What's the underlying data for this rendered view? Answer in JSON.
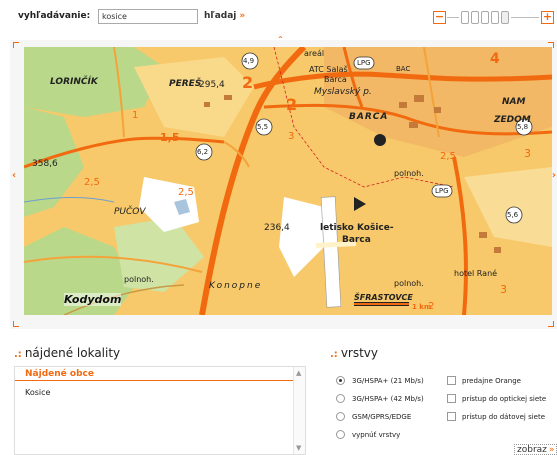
{
  "search": {
    "label": "vyhľadávanie:",
    "value": "kosice",
    "button_label": "hľadaj",
    "button_arrow": "»"
  },
  "zoom": {
    "minus": "−",
    "plus": "+",
    "steps": 5
  },
  "map": {
    "labels": {
      "lorincik": "LORINČÍK",
      "peres": "PEREŠ",
      "pereslevel": "295,4",
      "myslavsky": "Myslavský p.",
      "barca": "BARCA",
      "areal": "areál",
      "atc": "ATC Salaš",
      "barca2": "Barca",
      "nam": "NAM",
      "zedom": "ZEDOM",
      "elev": "358,6",
      "puchov": "PUČOV",
      "letisko": "letisko Košice-",
      "letisko2": "Barca",
      "elev2": "236,4",
      "polnoh1": "polnoh.",
      "polnoh2": "polnoh.",
      "polnoh3": "polnoh.",
      "konopne": "Konopne",
      "kodydom": "Kodydom",
      "hotel": "hotel Rané",
      "sfrastovce": "ŠFRASTOVCE",
      "scale": "1 km",
      "n1": "1,5",
      "n2": "2,5",
      "n3": "2,5",
      "n4": "3",
      "n5": "2",
      "n6": "1",
      "n7": "3",
      "n8": "4",
      "n9": "2",
      "n10": "3",
      "n11": "2,5",
      "n12": "2",
      "rm1": "4,9",
      "rm2": "5,5",
      "rm3": "6,2",
      "rm4": "5,6",
      "rm5": "5,8",
      "lpg1": "LPG",
      "lpg2": "LPG",
      "bac": "BAC"
    }
  },
  "results": {
    "title": "nájdené lokality",
    "header": "Nájdené obce",
    "items": [
      "Kosice"
    ]
  },
  "layers": {
    "title": "vrstvy",
    "radios": [
      {
        "label": "3G/HSPA+ (21 Mb/s)",
        "selected": true
      },
      {
        "label": "3G/HSPA+ (42 Mb/s)",
        "selected": false
      },
      {
        "label": "GSM/GPRS/EDGE",
        "selected": false
      },
      {
        "label": "vypnúť vrstvy",
        "selected": false
      }
    ],
    "checks": [
      {
        "label": "predajne Orange",
        "checked": false
      },
      {
        "label": "prístup do optickej siete",
        "checked": false
      },
      {
        "label": "prístup do dátovej siete",
        "checked": false
      }
    ],
    "show_button": "zobraz",
    "show_arrow": "»"
  },
  "colors": {
    "accent": "#f26a10",
    "map_base": "#f7c96a",
    "road": "#f26a10"
  }
}
